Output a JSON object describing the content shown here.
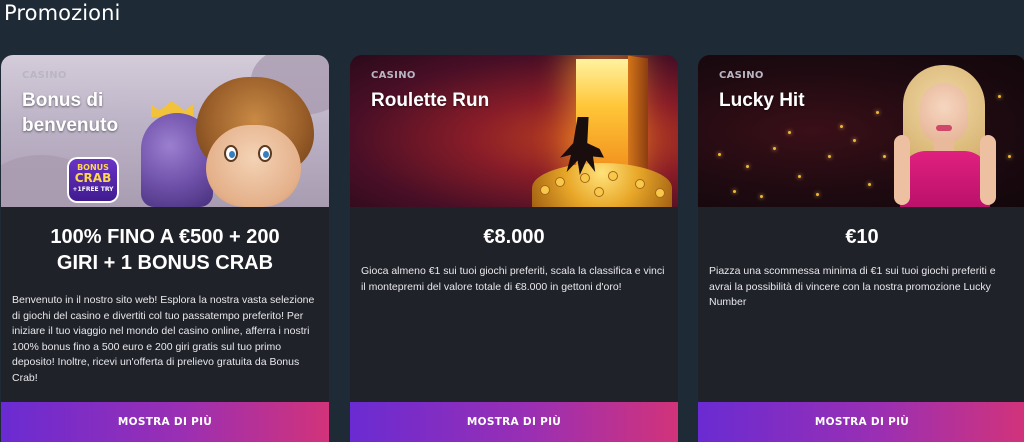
{
  "page": {
    "section_title": "Promozioni"
  },
  "cards": [
    {
      "category": "CASINO",
      "title": "Bonus di benvenuto",
      "logo": {
        "line1": "BONUS",
        "line2": "CRAB",
        "line3": "+1FREE TRY"
      },
      "headline": "100% FINO A €500 + 200 GIRI + 1 BONUS CRAB",
      "description": "Benvenuto in il nostro sito web! Esplora la nostra vasta selezione di giochi del casino e divertiti col tuo passatempo preferito! Per iniziare il tuo viaggio nel mondo del casino online, afferra i nostri 100% bonus fino a 500 euro e 200 giri gratis sul tuo primo deposito! Inoltre, ricevi un'offerta di prelievo gratuita da Bonus Crab!",
      "cta": "MOSTRA DI PIÙ"
    },
    {
      "category": "CASINO",
      "title": "Roulette Run",
      "headline": "€8.000",
      "description": "Gioca almeno €1 sui tuoi giochi preferiti, scala la classifica e vinci il montepremi del valore totale di €8.000 in gettoni d'oro!",
      "cta": "MOSTRA DI PIÙ"
    },
    {
      "category": "CASINO",
      "title": "Lucky Hit",
      "headline": "€10",
      "description": "Piazza una scommessa minima di €1 sui tuoi giochi preferiti e avrai la possibilità di vincere con la nostra promozione Lucky Number",
      "cta": "MOSTRA DI PIÙ"
    }
  ],
  "colors": {
    "page_background": "#1e2a36",
    "card_background": "#20222a",
    "cta_gradient_start": "#6a2bd2",
    "cta_gradient_end": "#d2337a"
  }
}
